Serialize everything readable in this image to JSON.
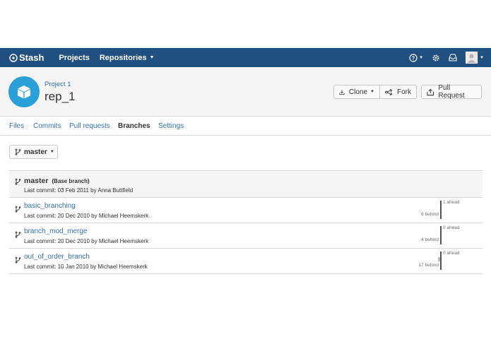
{
  "nav": {
    "logo": "Stash",
    "items": [
      {
        "label": "Projects"
      },
      {
        "label": "Repositories",
        "has_caret": true
      }
    ],
    "brand_color": "#205081"
  },
  "header": {
    "project": "Project 1",
    "repo": "rep_1",
    "buttons": {
      "clone": "Clone",
      "fork": "Fork",
      "pull_request": "Pull Request"
    }
  },
  "tabs": [
    {
      "label": "Files",
      "active": false
    },
    {
      "label": "Commits",
      "active": false
    },
    {
      "label": "Pull requests",
      "active": false
    },
    {
      "label": "Branches",
      "active": true
    },
    {
      "label": "Settings",
      "active": false
    }
  ],
  "branch_selector": {
    "value": "master"
  },
  "branches": [
    {
      "name": "master",
      "tag": "(Base branch)",
      "commit": "Last commit: 03 Feb 2011 by Anna Buttfield"
    },
    {
      "name": "basic_branching",
      "commit": "Last commit: 20 Dec 2010 by Michael Heemskerk",
      "ahead": "1 ahead",
      "behind": "6 behind"
    },
    {
      "name": "branch_mod_merge",
      "commit": "Last commit: 20 Dec 2010 by Michael Heemskerk",
      "ahead": "0 ahead",
      "behind": "4 behind"
    },
    {
      "name": "out_of_order_branch",
      "commit": "Last commit: 10 Jan 2010 by Michael Heemskerk",
      "ahead": "0 ahead",
      "behind": "17 behind"
    }
  ]
}
